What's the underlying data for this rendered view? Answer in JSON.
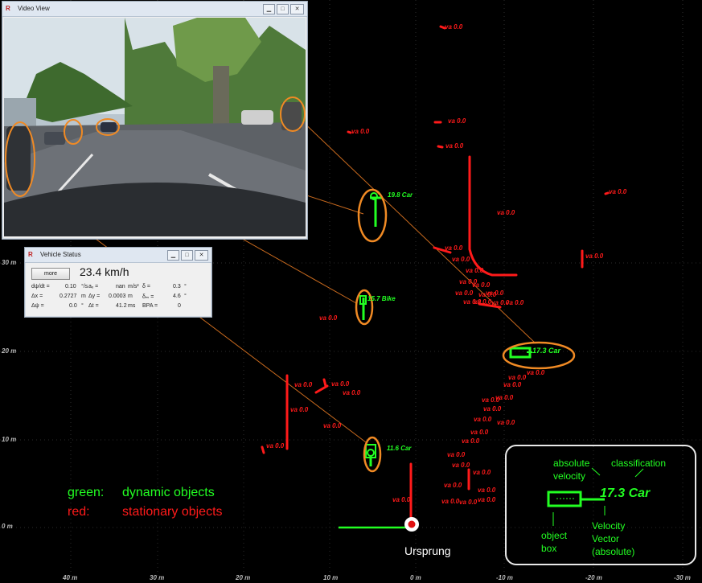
{
  "video_window": {
    "title": "Video View",
    "logo": "R"
  },
  "status_window": {
    "title": "Vehicle Status",
    "logo": "R",
    "more_label": "more",
    "speed": "23.4 km/h",
    "r1": {
      "a_lbl": "dψ/dt =",
      "a_val": "0.10",
      "a_unit": "°/s",
      "b_lbl": "aₓ =",
      "b_val": "nan",
      "b_unit": "m/s²",
      "c_lbl": "δ =",
      "c_val": "0.3",
      "c_unit": "°"
    },
    "r2": {
      "a_lbl": "Δx =",
      "a_val": "0.2727",
      "a_unit": "m",
      "b_lbl": "Δy =",
      "b_val": "0.0003",
      "b_unit": "m",
      "c_lbl": "δₘ =",
      "c_val": "4.6",
      "c_unit": "°"
    },
    "r3": {
      "a_lbl": "Δψ =",
      "a_val": "0.0",
      "a_unit": "°",
      "b_lbl": "Δt =",
      "b_val": "41.2",
      "b_unit": "ms",
      "c_lbl": "BPA =",
      "c_val": "0",
      "c_unit": ""
    }
  },
  "window_buttons": {
    "minimize": "▁",
    "maximize": "□",
    "close": "✕"
  },
  "axis": {
    "y_ticks": [
      "30 m",
      "20 m",
      "10 m",
      "0 m"
    ],
    "x_ticks": [
      "40 m",
      "30 m",
      "20 m",
      "10 m",
      "0 m",
      "-10 m",
      "-20 m",
      "-30 m"
    ]
  },
  "dynamic_objects": [
    {
      "label": "19.8 Car"
    },
    {
      "label": "15.7 Bike"
    },
    {
      "label": "17.3 Car"
    },
    {
      "label": "11.6  Car"
    }
  ],
  "stationary_label": "va 0.0",
  "legend": {
    "green_key": "green:",
    "green_text": "dynamic objects",
    "red_key": "red:",
    "red_text": "stationary objects"
  },
  "origin_label": "Ursprung",
  "annotation": {
    "sample": "17.3 Car",
    "absolute_velocity": [
      "absolute",
      "velocity"
    ],
    "classification": "classification",
    "object_box": [
      "object",
      "box"
    ],
    "velocity_vector": [
      "Velocity",
      "Vector",
      "(absolute)"
    ]
  },
  "colors": {
    "dynamic": "#22ff22",
    "stationary": "#ff1a1a",
    "marker": "#f08a24",
    "origin": "#e01010",
    "window_title": "#dfe7f1"
  },
  "icons": {
    "app_logo": "r-logo-icon",
    "origin": "origin-marker-icon"
  }
}
